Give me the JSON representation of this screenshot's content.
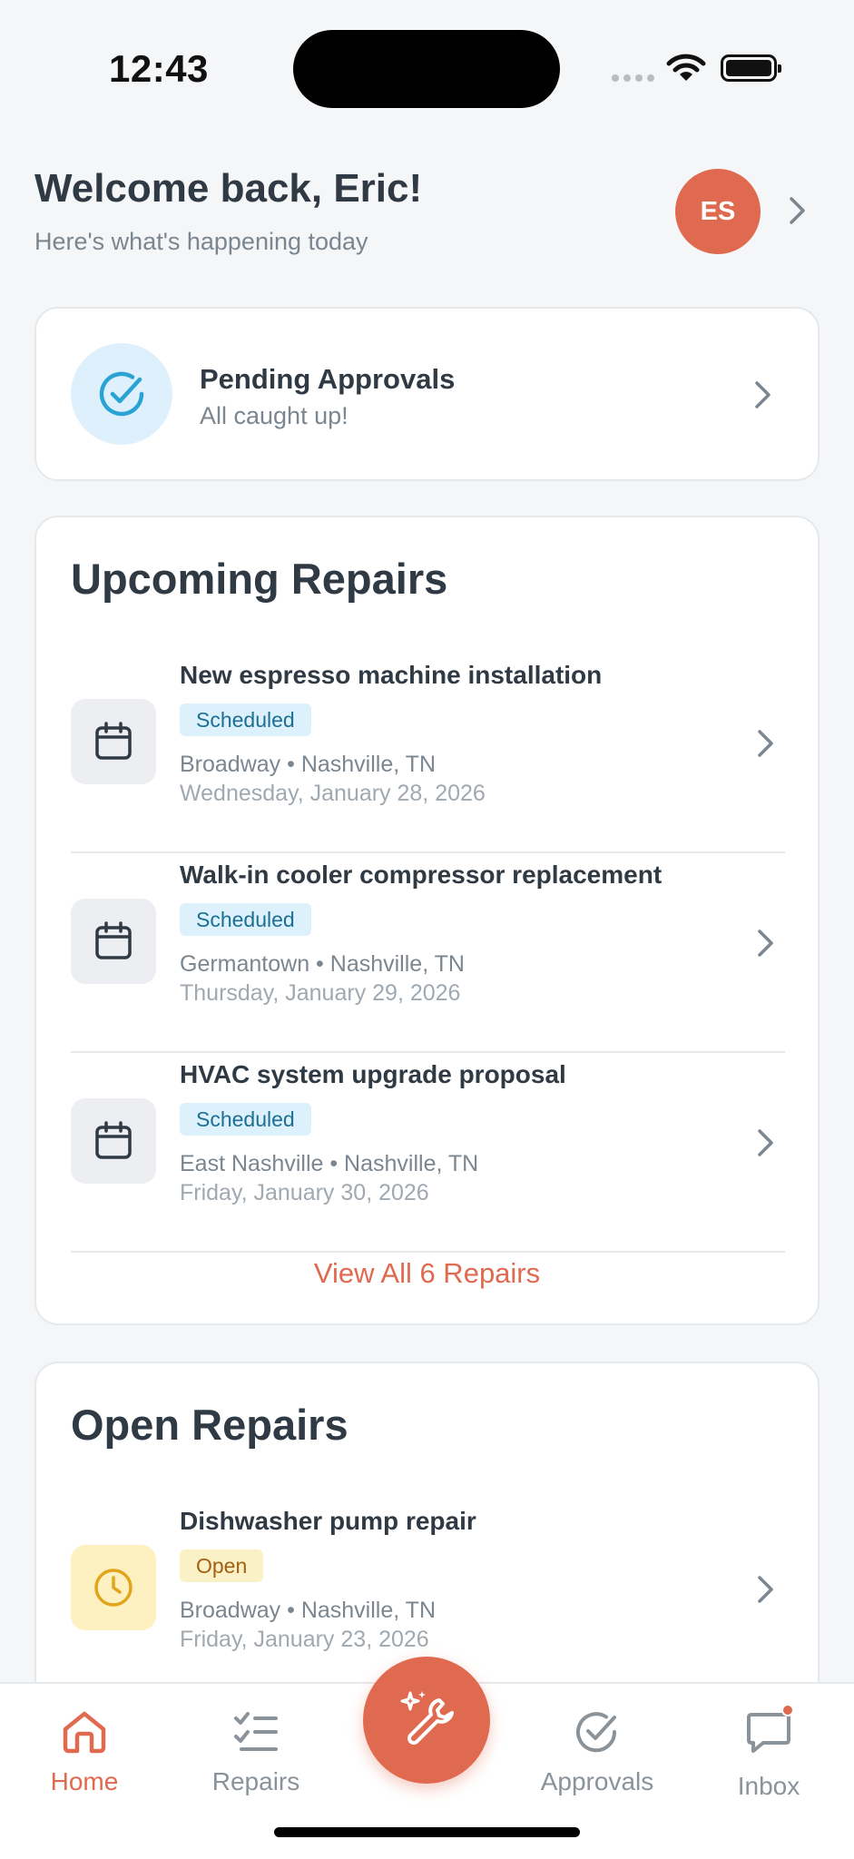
{
  "status_bar": {
    "time": "12:43"
  },
  "header": {
    "welcome": "Welcome back, Eric!",
    "subtitle": "Here's what's happening today",
    "avatar_initials": "ES"
  },
  "pending": {
    "title": "Pending Approvals",
    "subtitle": "All caught up!"
  },
  "upcoming": {
    "title": "Upcoming Repairs",
    "items": [
      {
        "title": "New espresso machine installation",
        "status": "Scheduled",
        "location": "Broadway • Nashville, TN",
        "date": "Wednesday, January 28, 2026"
      },
      {
        "title": "Walk-in cooler compressor replacement",
        "status": "Scheduled",
        "location": "Germantown • Nashville, TN",
        "date": "Thursday, January 29, 2026"
      },
      {
        "title": "HVAC system upgrade proposal",
        "status": "Scheduled",
        "location": "East Nashville • Nashville, TN",
        "date": "Friday, January 30, 2026"
      }
    ],
    "view_all": "View All 6 Repairs"
  },
  "open_repairs": {
    "title": "Open Repairs",
    "items": [
      {
        "title": "Dishwasher pump repair",
        "status": "Open",
        "location": "Broadway • Nashville, TN",
        "date": "Friday, January 23, 2026"
      }
    ]
  },
  "tabbar": {
    "home": "Home",
    "repairs": "Repairs",
    "approvals": "Approvals",
    "inbox": "Inbox",
    "active": "home",
    "inbox_has_unread": true
  },
  "colors": {
    "accent": "#e06a4f",
    "scheduled_bg": "#dcf1fb",
    "scheduled_text": "#1d6f93",
    "open_bg": "#fbf1c6",
    "open_text": "#a35f12"
  }
}
